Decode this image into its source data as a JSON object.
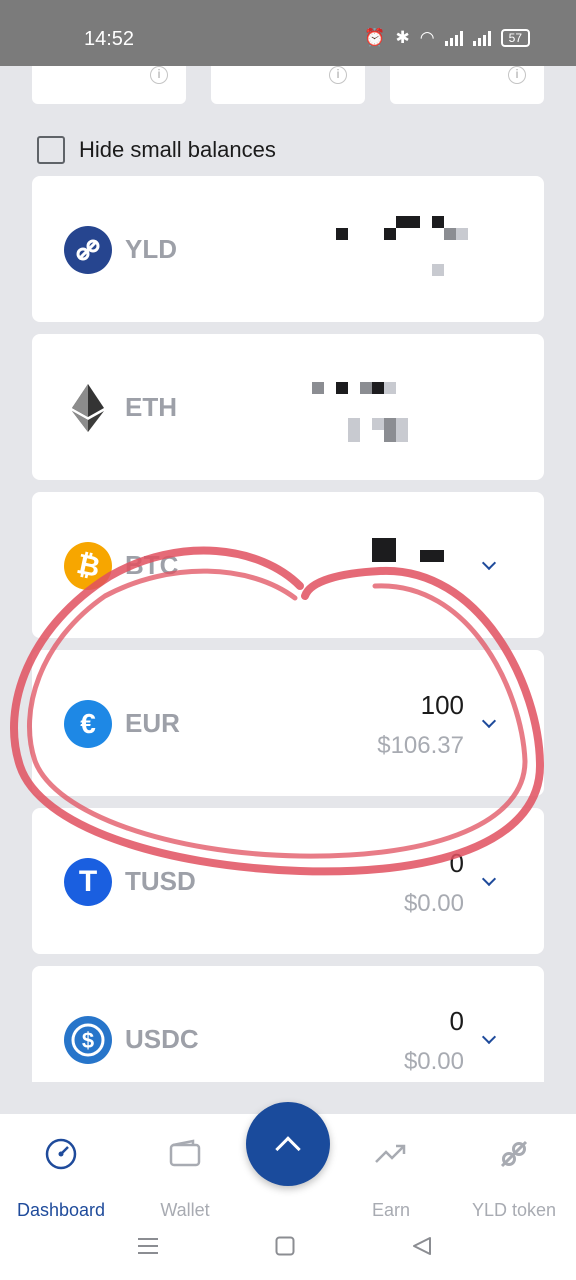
{
  "status_bar": {
    "time": "14:52",
    "battery": "57"
  },
  "hide_small_balances": {
    "label": "Hide small balances",
    "checked": false
  },
  "assets": [
    {
      "symbol": "YLD",
      "amount": "",
      "fiat": "",
      "redacted": true
    },
    {
      "symbol": "ETH",
      "amount": "",
      "fiat": "",
      "redacted": true
    },
    {
      "symbol": "BTC",
      "amount": "",
      "fiat": "",
      "redacted": true
    },
    {
      "symbol": "EUR",
      "amount": "100",
      "fiat": "$106.37"
    },
    {
      "symbol": "TUSD",
      "amount": "0",
      "fiat": "$0.00"
    },
    {
      "symbol": "USDC",
      "amount": "0",
      "fiat": "$0.00"
    }
  ],
  "nav": {
    "items": [
      {
        "label": "Dashboard",
        "icon": "dashboard-gauge-icon",
        "active": true
      },
      {
        "label": "Wallet",
        "icon": "wallet-icon",
        "active": false
      },
      {
        "label": "Earn",
        "icon": "trend-up-icon",
        "active": false
      },
      {
        "label": "YLD token",
        "icon": "yld-logo-icon",
        "active": false
      }
    ],
    "fab_icon": "chevron-up-icon"
  },
  "colors": {
    "accent": "#1f4b9b",
    "highlight": "#e0505f",
    "eur": "#1e88e5",
    "btc": "#f7a600",
    "tusd": "#1a5fe0",
    "usdc": "#2775ca"
  }
}
